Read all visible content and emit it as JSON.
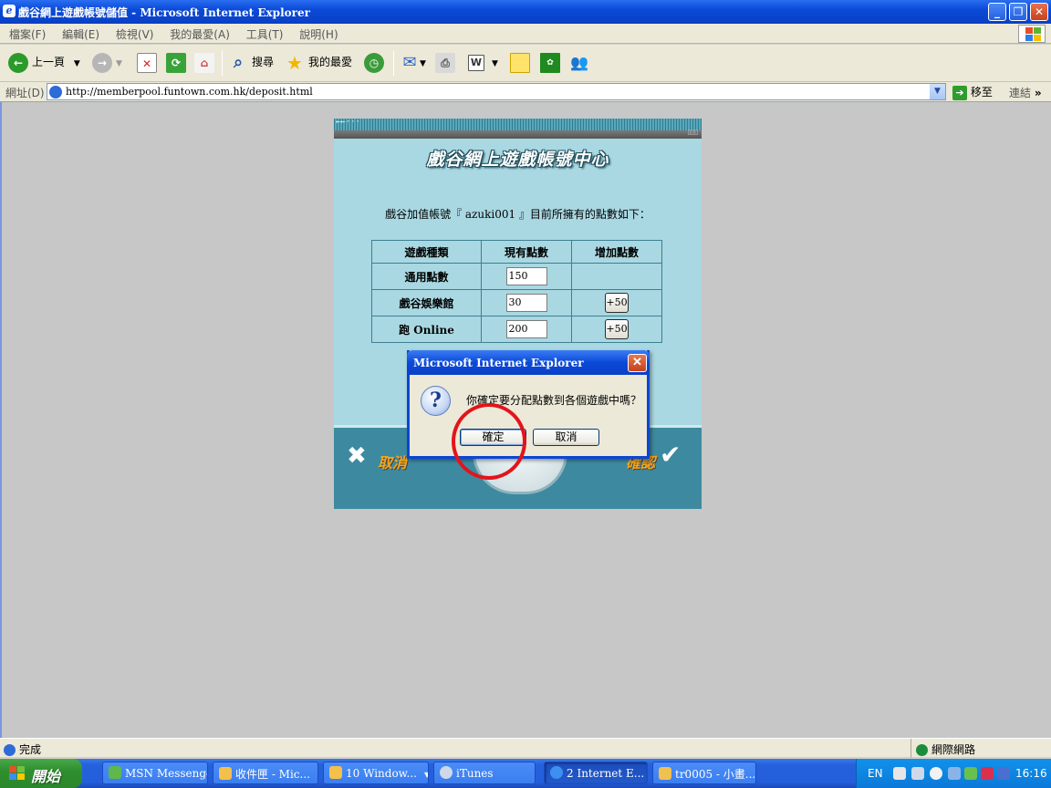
{
  "window": {
    "title": "戲谷網上遊戲帳號儲值 - Microsoft Internet Explorer"
  },
  "menu": [
    "檔案(F)",
    "編輯(E)",
    "檢視(V)",
    "我的最愛(A)",
    "工具(T)",
    "說明(H)"
  ],
  "toolbar": {
    "back": "上一頁",
    "search": "搜尋",
    "favorites": "我的最愛"
  },
  "address": {
    "label": "網址(D)",
    "url": "http://memberpool.funtown.com.hk/deposit.html",
    "go": "移至",
    "links": "連結"
  },
  "page": {
    "arrows": "←←···",
    "heading": "戲谷網上遊戲帳號中心",
    "description": "戲谷加值帳號『 azuki001 』目前所擁有的點數如下：",
    "table": {
      "headers": [
        "遊戲種類",
        "現有點數",
        "增加點數"
      ],
      "rows": [
        {
          "game": "通用點數",
          "points": "150",
          "add": ""
        },
        {
          "game": "戲谷娛樂館",
          "points": "30",
          "add": "+50"
        },
        {
          "game": "跑 Online",
          "points": "200",
          "add": "+50"
        }
      ]
    },
    "cancel": "取消",
    "confirm": "確認"
  },
  "dialog": {
    "title": "Microsoft Internet Explorer",
    "message": "你確定要分配點數到各個遊戲中嗎？",
    "ok": "確定",
    "cancel": "取消"
  },
  "status": {
    "text": "完成",
    "zone": "網際網路"
  },
  "taskbar": {
    "start": "開始",
    "tasks": [
      "MSN Messenger",
      "收件匣 - Mic...",
      "10 Window...",
      "iTunes",
      "2 Internet E...",
      "tr0005 - 小畫..."
    ],
    "lang": "EN",
    "clock": "16:16"
  },
  "colors": {
    "accent": "#0a49d8",
    "panel": "#a9d8e2",
    "highlight": "#e3141b",
    "taskbar": "#245edb"
  }
}
